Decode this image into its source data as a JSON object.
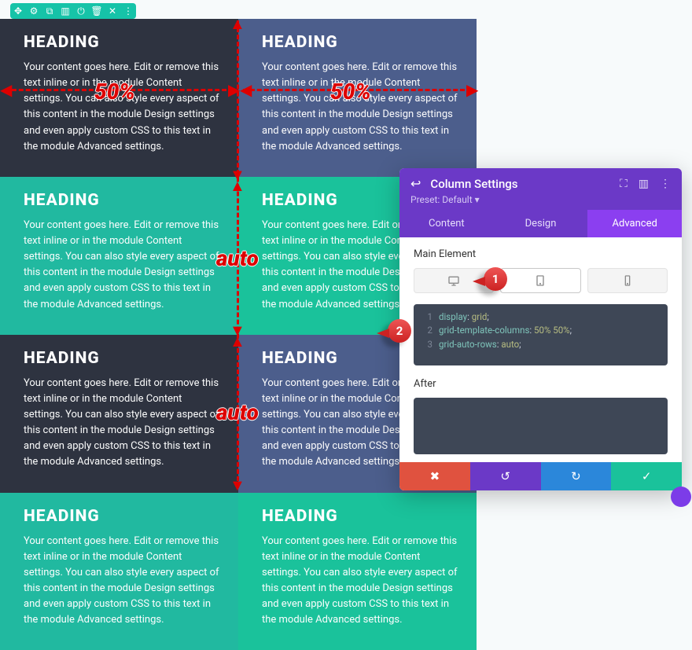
{
  "heading": "HEADING",
  "body_text": "Your content goes here. Edit or remove this text inline or in the module Content settings. You can also style every aspect of this content in the module Design settings and even apply custom CSS to this text in the module Advanced settings.",
  "overlays": {
    "col_left": "50%",
    "col_right": "50%",
    "row_a": "auto",
    "row_b": "auto"
  },
  "bubbles": {
    "one": "1",
    "two": "2"
  },
  "toolbar_icons": [
    "move-icon",
    "gear-icon",
    "column-icon",
    "grid-icon",
    "power-icon",
    "trash-icon",
    "close-icon",
    "more-icon"
  ],
  "panel": {
    "title": "Column Settings",
    "preset": "Preset: Default ▾",
    "header_icons": [
      "undo-icon",
      "expand-icon",
      "columns-icon",
      "more-icon"
    ],
    "tabs": [
      "Content",
      "Design",
      "Advanced"
    ],
    "active_tab": 2,
    "section_main": "Main Element",
    "section_after": "After",
    "devices": [
      "desktop",
      "tablet",
      "phone"
    ],
    "active_device": 1,
    "css_lines": [
      {
        "n": "1",
        "prop": "display",
        "val": "grid"
      },
      {
        "n": "2",
        "prop": "grid-template-columns",
        "val": "50% 50%"
      },
      {
        "n": "3",
        "prop": "grid-auto-rows",
        "val": "auto"
      }
    ],
    "actions": [
      "✖",
      "↺",
      "↻",
      "✓"
    ]
  },
  "colors": {
    "dark": "#2e3340",
    "blue": "#4c5e8c",
    "teal": "#21b9a0",
    "green": "#1ac29b",
    "purple": "#6b39c7",
    "violet": "#8b3ff0",
    "red": "#e0523f",
    "action_blue": "#2b87da"
  }
}
